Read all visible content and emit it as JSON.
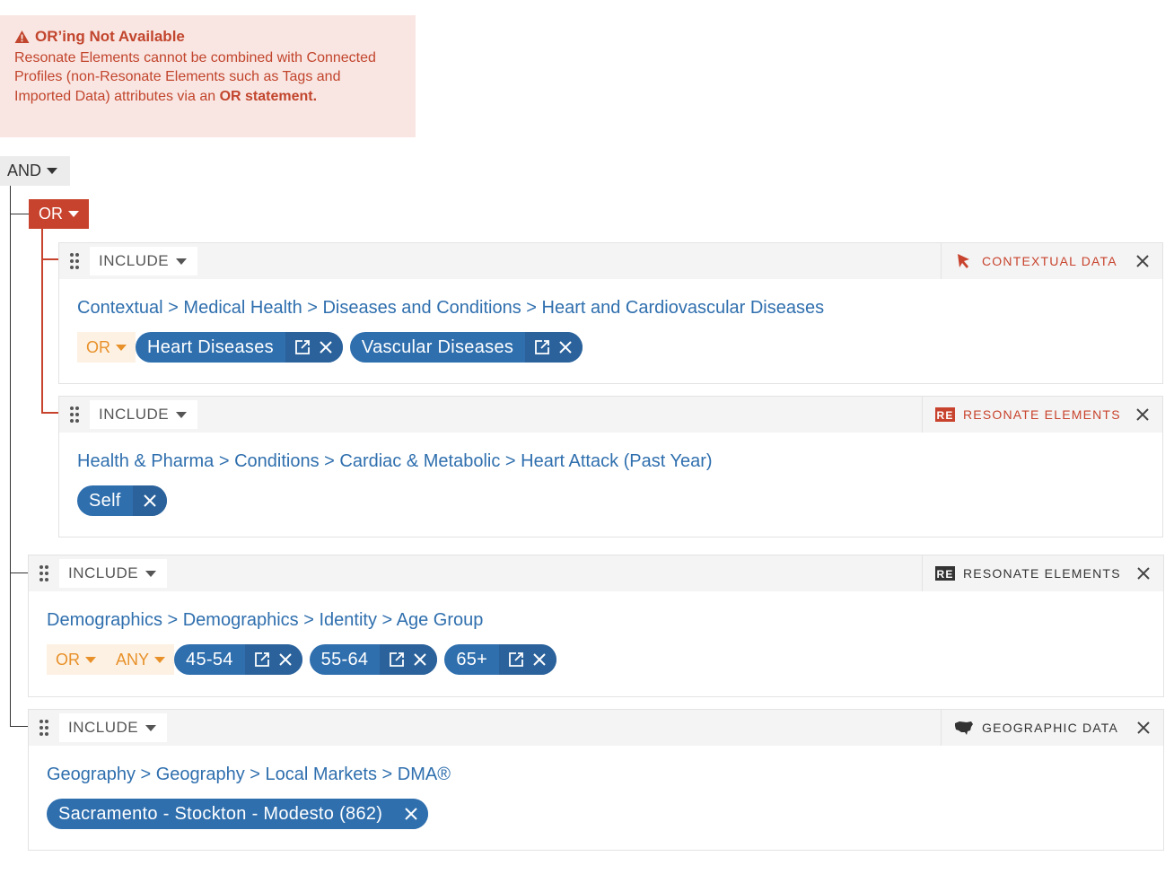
{
  "warning": {
    "title": "OR’ing Not Available",
    "text": "Resonate Elements cannot be combined with Connected Profiles (non-Resonate Elements such as Tags and Imported Data) attributes via an",
    "emphasis": "OR statement."
  },
  "operators": {
    "root": "AND",
    "group": "OR"
  },
  "colors": {
    "accent_red": "#c8432d",
    "chip_blue": "#2f6fae",
    "modifier_orange": "#e8912a",
    "warning_bg": "#f9e6e2"
  },
  "rules": [
    {
      "mode": "INCLUDE",
      "source": "CONTEXTUAL DATA",
      "source_icon": "cursor-arrow-icon",
      "path": "Contextual > Medical Health > Diseases and Conditions > Heart and Cardiovascular Diseases",
      "modifiers": [
        "OR"
      ],
      "values": [
        "Heart Diseases",
        "Vascular Diseases"
      ]
    },
    {
      "mode": "INCLUDE",
      "source": "RESONATE ELEMENTS",
      "source_icon": "re-badge-icon",
      "path": "Health & Pharma > Conditions > Cardiac & Metabolic > Heart Attack (Past Year)",
      "modifiers": [],
      "values": [
        "Self"
      ]
    },
    {
      "mode": "INCLUDE",
      "source": "RESONATE ELEMENTS",
      "source_icon": "re-badge-icon",
      "path": "Demographics > Demographics > Identity > Age Group",
      "modifiers": [
        "OR",
        "ANY"
      ],
      "values": [
        "45-54",
        "55-64",
        "65+"
      ]
    },
    {
      "mode": "INCLUDE",
      "source": "GEOGRAPHIC DATA",
      "source_icon": "us-map-icon",
      "path": "Geography > Geography > Local Markets > DMA®",
      "modifiers": [],
      "values": [
        "Sacramento - Stockton - Modesto (862)"
      ]
    }
  ]
}
